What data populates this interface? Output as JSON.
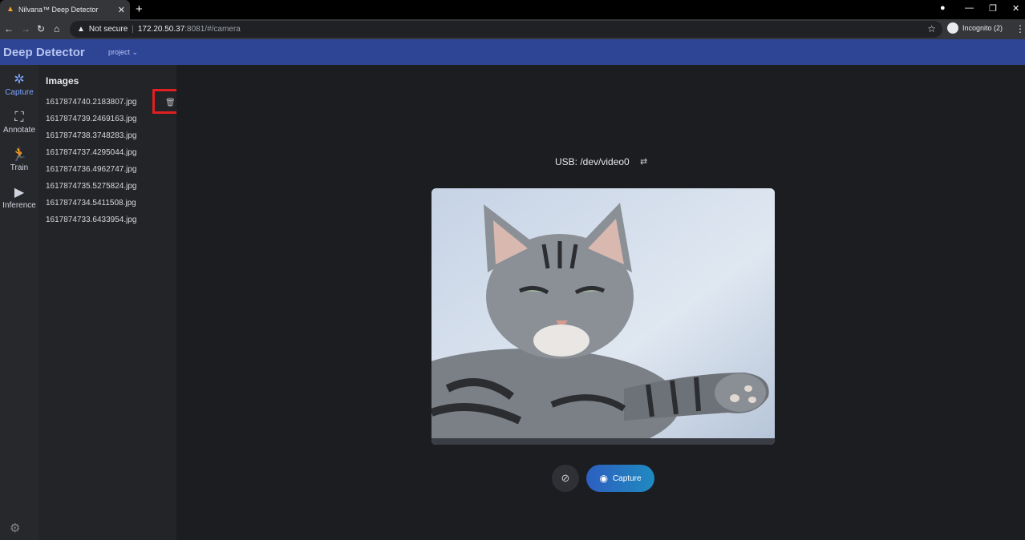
{
  "browser": {
    "tab_title": "Nilvana™ Deep Detector",
    "tab_close": "✕",
    "new_tab": "+",
    "security_label": "Not secure",
    "url_host": "172.20.50.37",
    "url_path": ":8081/#/camera",
    "incognito_label": "Incognito (2)"
  },
  "app": {
    "title": "Deep Detector",
    "project_menu": "project ⌄"
  },
  "sidenav": {
    "items": [
      {
        "label": "Capture",
        "icon": "aperture-icon"
      },
      {
        "label": "Annotate",
        "icon": "bounding-box-icon"
      },
      {
        "label": "Train",
        "icon": "running-person-icon"
      },
      {
        "label": "Inference",
        "icon": "play-folder-icon"
      }
    ]
  },
  "images": {
    "title": "Images",
    "files": [
      "1617874740.2183807.jpg",
      "1617874739.2469163.jpg",
      "1617874738.3748283.jpg",
      "1617874737.4295044.jpg",
      "1617874736.4962747.jpg",
      "1617874735.5275824.jpg",
      "1617874734.5411508.jpg",
      "1617874733.6433954.jpg"
    ]
  },
  "camera": {
    "source_label": "USB: /dev/video0",
    "capture_label": "Capture"
  }
}
